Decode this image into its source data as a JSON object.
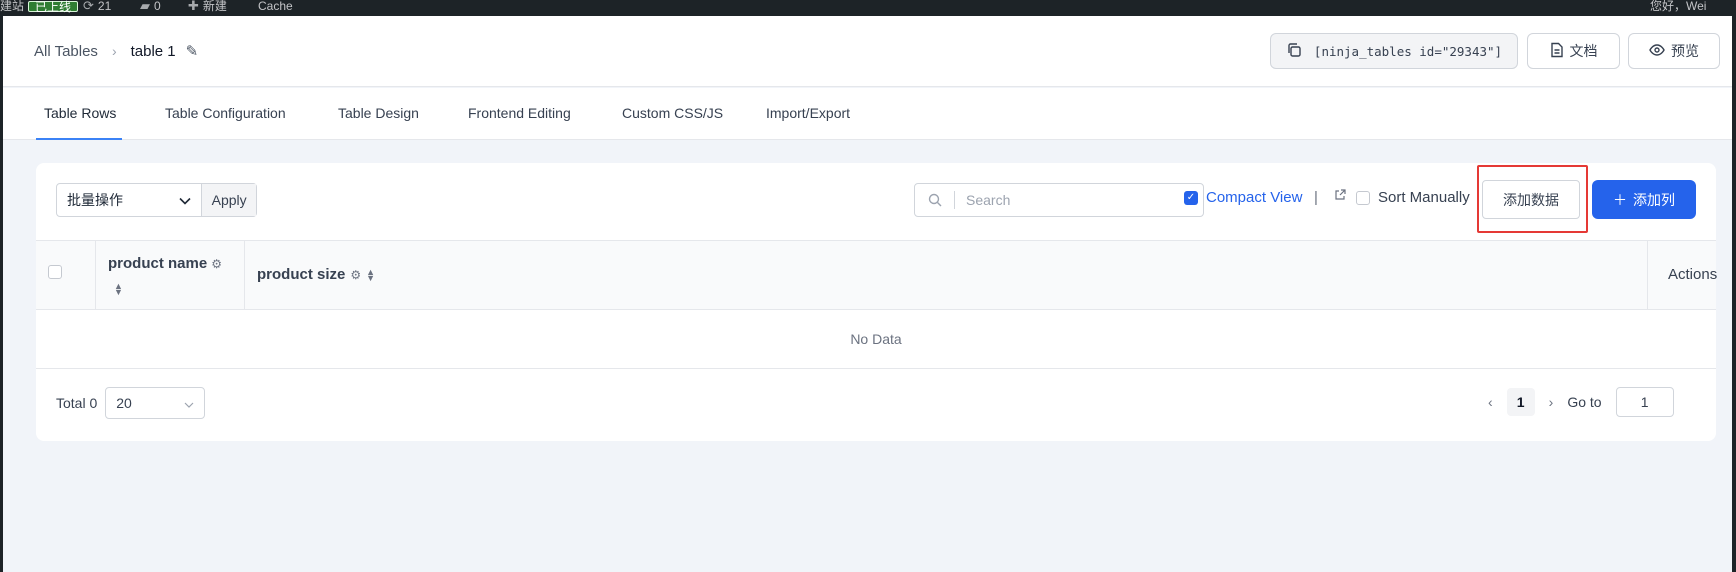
{
  "adminbar": {
    "site": "建站",
    "status_badge": "已上线",
    "updates_count": "21",
    "comments_count": "0",
    "new_label": "新建",
    "cache_label": "Cache",
    "greeting": "您好，Wei"
  },
  "breadcrumb": {
    "all_tables": "All Tables",
    "current": "table 1"
  },
  "header": {
    "shortcode": "[ninja_tables id=\"29343\"]",
    "docs_label": "文档",
    "preview_label": "预览"
  },
  "tabs": [
    {
      "label": "Table Rows",
      "active": true
    },
    {
      "label": "Table Configuration"
    },
    {
      "label": "Table Design"
    },
    {
      "label": "Frontend Editing"
    },
    {
      "label": "Custom CSS/JS"
    },
    {
      "label": "Import/Export"
    }
  ],
  "toolbar": {
    "bulk_action": "批量操作",
    "apply": "Apply",
    "search_placeholder": "Search",
    "compact_view": "Compact View",
    "compact_checked": true,
    "divider": "|",
    "sort_manually": "Sort Manually",
    "add_data": "添加数据",
    "add_column": "添加列"
  },
  "table": {
    "columns": [
      "product name",
      "product size"
    ],
    "actions_header": "Actions",
    "empty_text": "No Data"
  },
  "footer": {
    "total": "Total 0",
    "page_size": "20",
    "current_page": "1",
    "goto_label": "Go to",
    "goto_value": "1"
  },
  "colors": {
    "primary": "#2563eb",
    "highlight_box": "#e53935",
    "adminbar_bg": "#1d2327"
  }
}
